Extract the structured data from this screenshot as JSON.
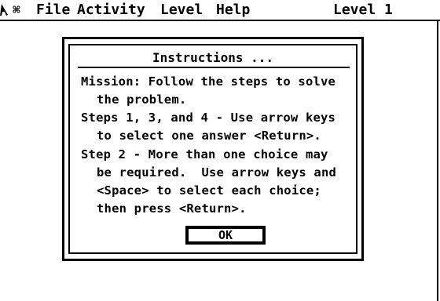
{
  "menubar": {
    "apple_icon": "apple-icon",
    "command_icon": "command-key-icon",
    "command_glyph": "⌘",
    "items": [
      "File",
      "Activity",
      "Level",
      "Help"
    ],
    "status": "Level 1"
  },
  "dialog": {
    "title": "Instructions ...",
    "lines": [
      "Mission: Follow the steps to solve",
      "the problem.",
      "Steps 1, 3, and 4 - Use arrow keys",
      "to select one answer <Return>.",
      "Step 2 - More than one choice may",
      "be required.  Use arrow keys and",
      "<Space> to select each choice;",
      "then press <Return>."
    ],
    "ok_label": "OK"
  }
}
